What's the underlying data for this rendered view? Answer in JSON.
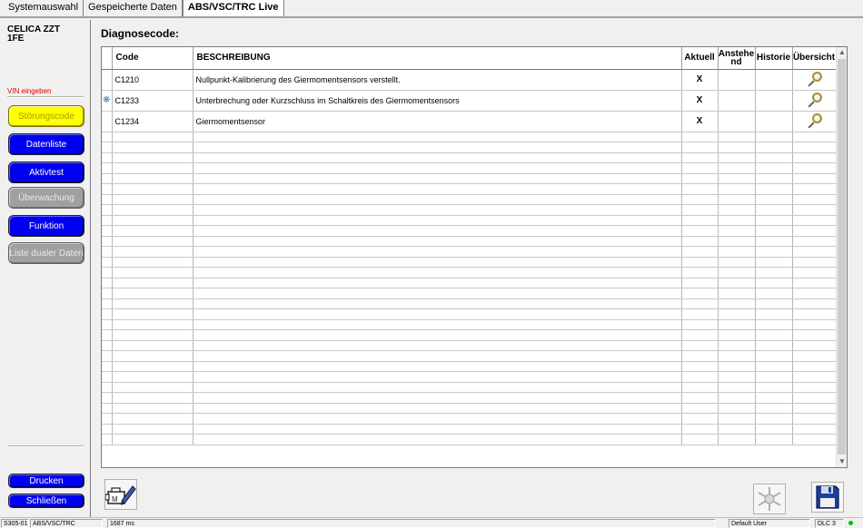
{
  "tabs": [
    "Systemauswahl",
    "Gespeicherte Daten",
    "ABS/VSC/TRC Live"
  ],
  "vehicle": {
    "line1": "CELICA ZZT",
    "line2": "1FE"
  },
  "vin_label": "VIN eingeben",
  "sidebar_buttons": [
    {
      "label": "Störungscode",
      "style": "yellow"
    },
    {
      "label": "Datenliste",
      "style": "blue"
    },
    {
      "label": "Aktivtest",
      "style": "blue"
    },
    {
      "label": "Überwachung",
      "style": "gray"
    },
    {
      "label": "Funktion",
      "style": "blue"
    },
    {
      "label": "Liste dualer Daten",
      "style": "gray"
    }
  ],
  "bottom_buttons": {
    "print": "Drucken",
    "close": "Schließen"
  },
  "main_title": "Diagnosecode:",
  "columns": {
    "code": "Code",
    "description": "BESCHREIBUNG",
    "current": "Aktuell",
    "pending": "Anstehe nd",
    "history": "Historie",
    "overview": "Übersicht"
  },
  "rows": [
    {
      "code": "C1210",
      "description": "Nullpunkt-Kalibrierung des Giermomentsensors verstellt.",
      "current": "X",
      "pending": "",
      "history": "",
      "gear": false
    },
    {
      "code": "C1233",
      "description": "Unterbrechung oder Kurzschluss im Schaltkreis des Giermomentsensors",
      "current": "X",
      "pending": "",
      "history": "",
      "gear": true
    },
    {
      "code": "C1234",
      "description": "Giermomentsensor",
      "current": "X",
      "pending": "",
      "history": "",
      "gear": false
    }
  ],
  "status": {
    "id": "S305-01",
    "system": "ABS/VSC/TRC",
    "timing": "1687 ms",
    "user": "Default User",
    "connection": "DLC 3"
  },
  "colors": {
    "accent_blue": "#0000f0",
    "active_yellow": "#ffff00",
    "disabled_gray": "#a0a0a0",
    "vin_red": "#e00000",
    "status_ok": "#00c000"
  }
}
